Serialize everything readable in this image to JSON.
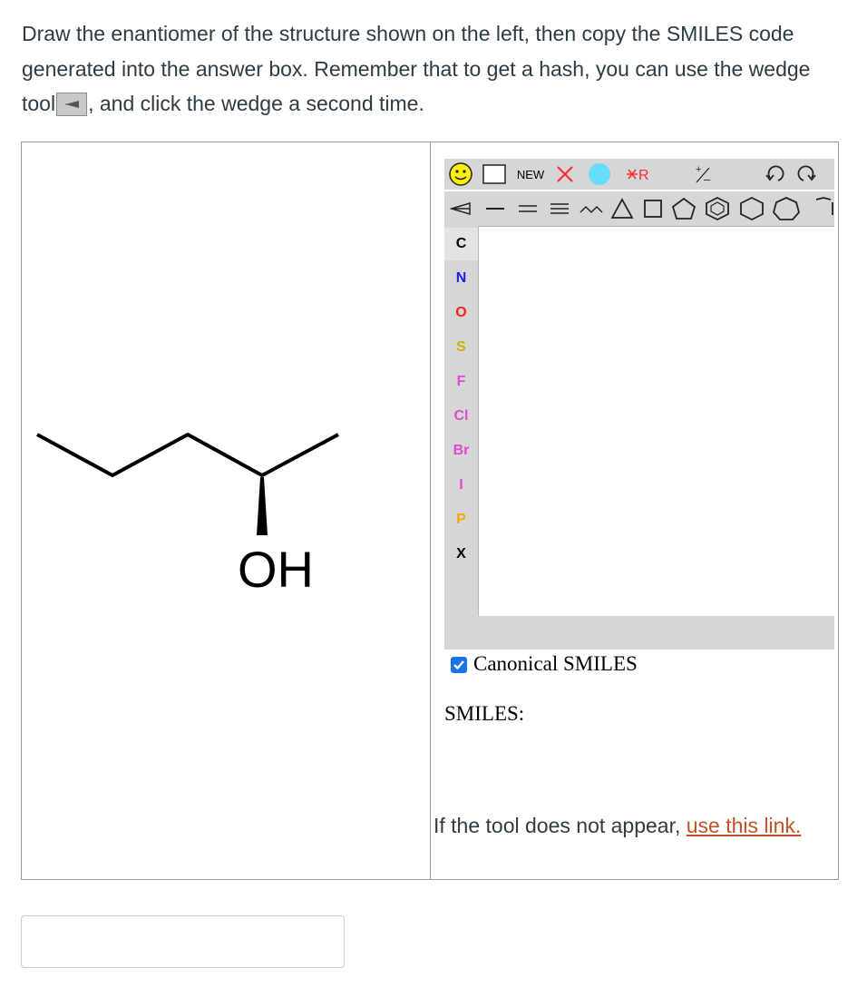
{
  "prompt": {
    "part1": "Draw the enantiomer of the structure shown on the left, then copy the SMILES code generated into the answer box.  Remember that to get a hash, you can use the wedge tool",
    "part2": ", and click the wedge a second time."
  },
  "structure": {
    "hydroxyl_label": "OH"
  },
  "editor": {
    "new_label": "NEW",
    "rgroup_label": "R",
    "atoms": [
      "C",
      "N",
      "O",
      "S",
      "F",
      "Cl",
      "Br",
      "I",
      "P",
      "X"
    ],
    "atom_colors": {
      "C": "#000000",
      "N": "#1a1aff",
      "O": "#ff1a1a",
      "S": "#c8b400",
      "F": "#e04ad0",
      "Cl": "#e04ad0",
      "Br": "#e04ad0",
      "I": "#e04ad0",
      "P": "#ffa500",
      "X": "#000000"
    }
  },
  "options": {
    "canonical_label": "Canonical SMILES",
    "canonical_checked": true,
    "smiles_label": "SMILES:"
  },
  "fallback": {
    "text": "If the tool does not appear, ",
    "link_text": "use this link."
  },
  "answer": {
    "value": ""
  },
  "colors": {
    "text": "#2d3b45",
    "link": "#c4502a",
    "checkbox": "#1a73e8",
    "toolbar": "#d6d6d6"
  }
}
